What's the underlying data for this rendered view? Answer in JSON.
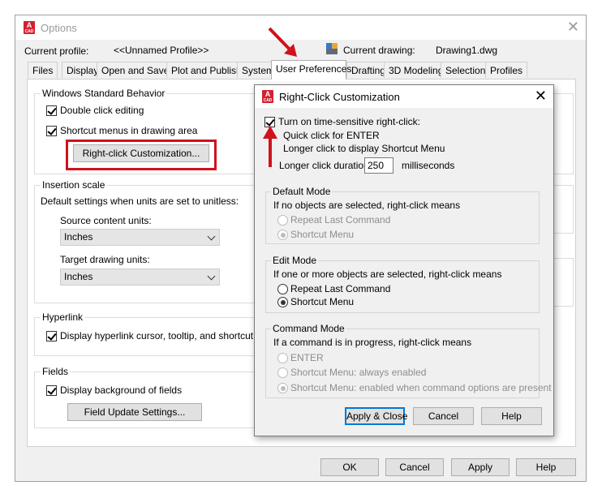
{
  "options": {
    "title": "Options",
    "current_profile_label": "Current profile:",
    "current_profile_value": "<<Unnamed Profile>>",
    "current_drawing_label": "Current drawing:",
    "current_drawing_value": "Drawing1.dwg",
    "tabs": [
      "Files",
      "Display",
      "Open and Save",
      "Plot and Publish",
      "System",
      "User Preferences",
      "Drafting",
      "3D Modeling",
      "Selection",
      "Profiles"
    ],
    "active_tab": "User Preferences",
    "windows_behavior": {
      "title": "Windows Standard Behavior",
      "double_click": "Double click editing",
      "shortcut_menus": "Shortcut menus in drawing area",
      "rc_button": "Right-click Customization..."
    },
    "insertion": {
      "title": "Insertion scale",
      "desc": "Default settings when units are set to unitless:",
      "source_label": "Source content units:",
      "source_value": "Inches",
      "target_label": "Target drawing units:",
      "target_value": "Inches"
    },
    "hyperlink": {
      "title": "Hyperlink",
      "display": "Display hyperlink cursor, tooltip, and shortcut menu"
    },
    "fields": {
      "title": "Fields",
      "display": "Display background of fields",
      "update_button": "Field Update Settings..."
    },
    "buttons": {
      "ok": "OK",
      "cancel": "Cancel",
      "apply": "Apply",
      "help": "Help"
    }
  },
  "rc_dialog": {
    "title": "Right-Click Customization",
    "time_sensitive": "Turn on time-sensitive right-click:",
    "quick_click": "Quick click for ENTER",
    "longer_click": "Longer click to display Shortcut Menu",
    "duration_label": "Longer click duration:",
    "duration_value": "250",
    "duration_unit": "milliseconds",
    "default_mode": {
      "title": "Default Mode",
      "desc": "If no objects are selected, right-click means",
      "opt1": "Repeat Last Command",
      "opt2": "Shortcut Menu"
    },
    "edit_mode": {
      "title": "Edit Mode",
      "desc": "If one or more objects are selected, right-click means",
      "opt1": "Repeat Last Command",
      "opt2": "Shortcut Menu"
    },
    "command_mode": {
      "title": "Command Mode",
      "desc": "If a command is in progress, right-click means",
      "opt1": "ENTER",
      "opt2": "Shortcut Menu: always enabled",
      "opt3": "Shortcut Menu: enabled when command options are present"
    },
    "buttons": {
      "apply_close": "Apply & Close",
      "cancel": "Cancel",
      "help": "Help"
    }
  },
  "annotation_color": "#d0121b"
}
